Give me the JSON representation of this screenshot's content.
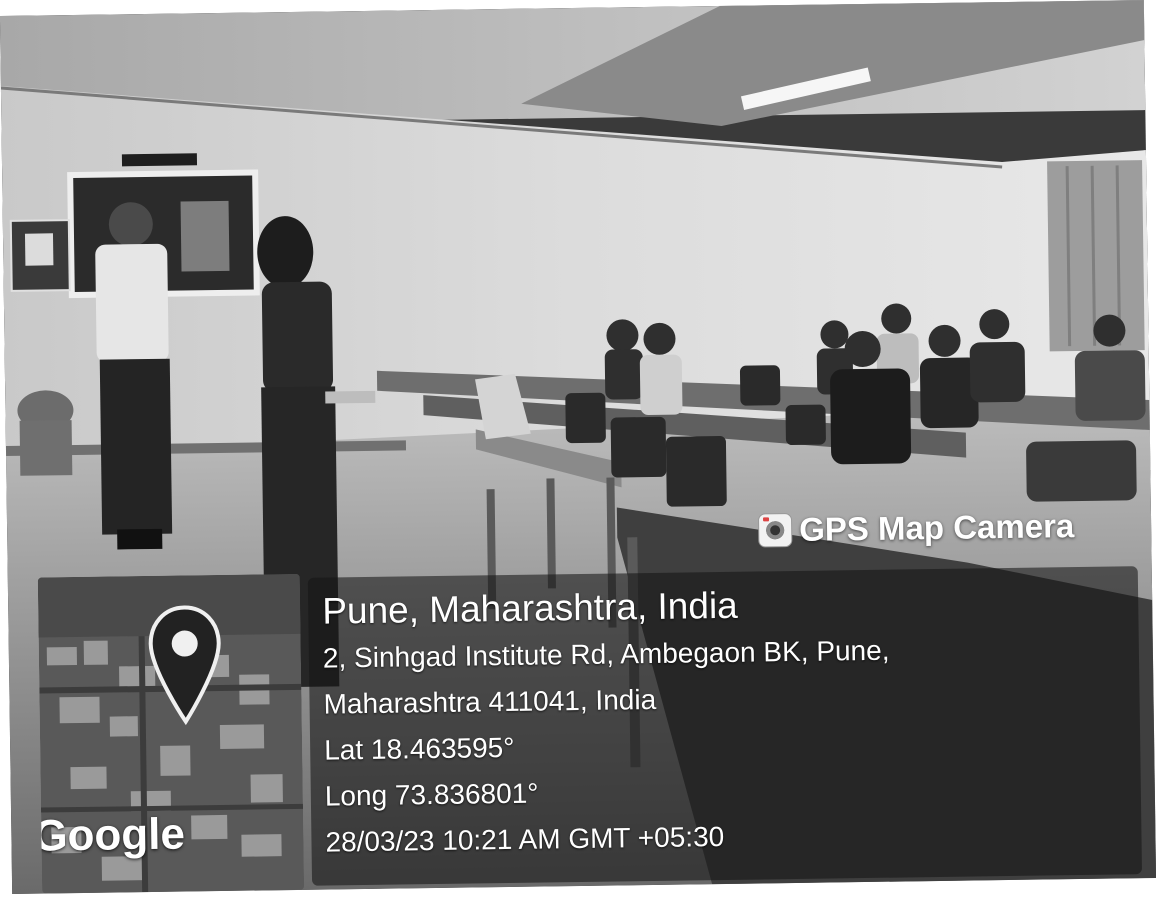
{
  "watermark": {
    "app_name": "GPS Map Camera",
    "icon": "camera-app-icon"
  },
  "location": {
    "title": "Pune, Maharashtra, India",
    "address_line1": "2, Sinhgad Institute Rd, Ambegaon BK, Pune,",
    "address_line2": "Maharashtra 411041, India",
    "latitude": "Lat 18.463595°",
    "longitude": "Long 73.836801°",
    "timestamp": "28/03/23 10:21 AM GMT +05:30"
  },
  "map": {
    "provider": "Google",
    "pin_icon": "map-pin-icon"
  }
}
